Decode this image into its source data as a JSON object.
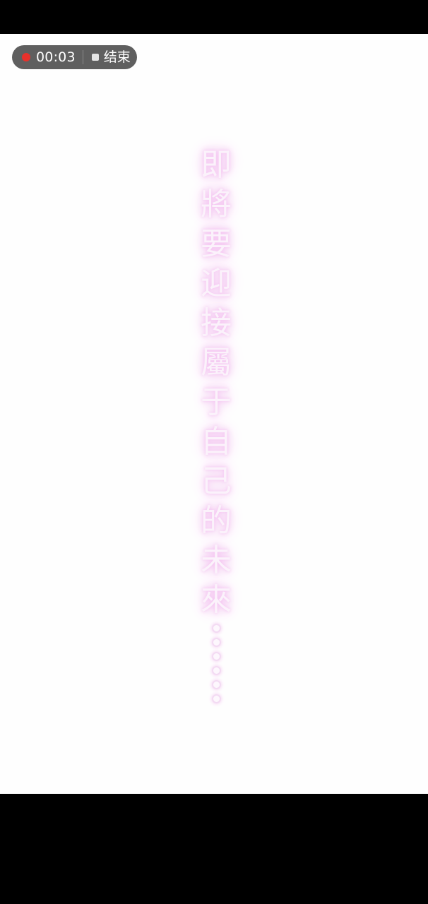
{
  "recording": {
    "time": "00:03",
    "stop_label": "结束",
    "dot_color": "#e8312b"
  },
  "caption": {
    "characters": [
      "即",
      "將",
      "要",
      "迎",
      "接",
      "屬",
      "于",
      "自",
      "己",
      "的",
      "未",
      "來"
    ],
    "trailing": "……",
    "glow_color": "#f3c0f0"
  }
}
